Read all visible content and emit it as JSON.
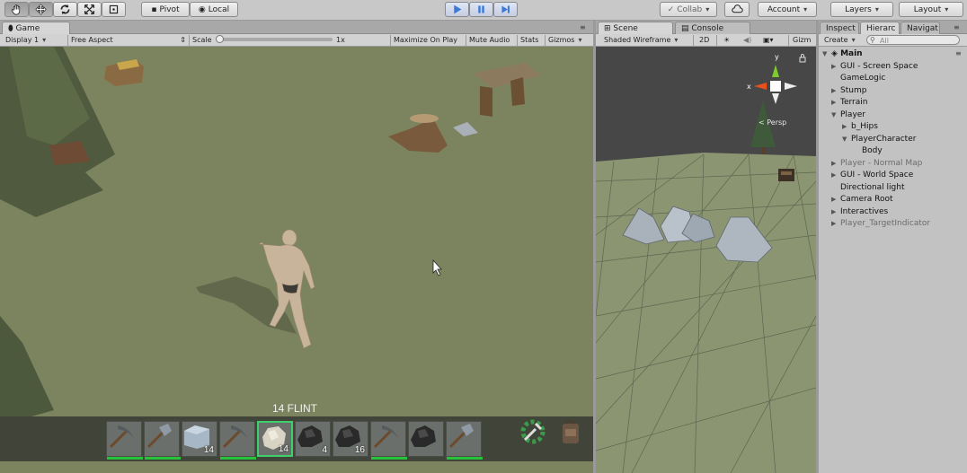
{
  "toolbar": {
    "pivot_label": "Pivot",
    "local_label": "Local",
    "collab_label": "Collab",
    "account_label": "Account",
    "layers_label": "Layers",
    "layout_label": "Layout",
    "accent_color": "#3a79d8"
  },
  "game_panel": {
    "tab_label": "Game",
    "display_label": "Display 1",
    "aspect_label": "Free Aspect",
    "scale_label": "Scale",
    "scale_value": "1x",
    "maximize_label": "Maximize On Play",
    "mute_label": "Mute Audio",
    "stats_label": "Stats",
    "gizmos_label": "Gizmos",
    "selected_item_text": "14 FLINT",
    "hotbar": [
      {
        "icon": "pickaxe-icon",
        "count": "",
        "durability": 1
      },
      {
        "icon": "hammer-icon",
        "count": "",
        "durability": 1
      },
      {
        "icon": "stone-block-icon",
        "count": "14",
        "durability": 0
      },
      {
        "icon": "pickaxe-icon",
        "count": "",
        "durability": 1
      },
      {
        "icon": "flint-icon",
        "count": "14",
        "durability": 0
      },
      {
        "icon": "coal-icon",
        "count": "4",
        "durability": 0
      },
      {
        "icon": "coal-icon",
        "count": "16",
        "durability": 0
      },
      {
        "icon": "pickaxe-icon",
        "count": "",
        "durability": 1
      },
      {
        "icon": "coal-icon",
        "count": "",
        "durability": 0
      },
      {
        "icon": "hammer-icon",
        "count": "",
        "durability": 1
      }
    ]
  },
  "scene_panel": {
    "scene_tab": "Scene",
    "console_tab": "Console",
    "shading_label": "Shaded Wireframe",
    "mode_2d": "2D",
    "gizmos_label": "Gizm",
    "persp_label": "< Persp",
    "axis_y": "y",
    "axis_x": "x"
  },
  "hierarchy_panel": {
    "inspector_tab": "Inspect",
    "hierarchy_tab": "Hierarc",
    "navigation_tab": "Navigat",
    "create_label": "Create",
    "search_placeholder": "All",
    "items": [
      {
        "label": "Main",
        "indent": 0,
        "arrow": "▼",
        "dim": false
      },
      {
        "label": "GUI - Screen Space",
        "indent": 1,
        "arrow": "▶",
        "dim": false
      },
      {
        "label": "GameLogic",
        "indent": 1,
        "arrow": "",
        "dim": false
      },
      {
        "label": "Stump",
        "indent": 1,
        "arrow": "▶",
        "dim": false
      },
      {
        "label": "Terrain",
        "indent": 1,
        "arrow": "▶",
        "dim": false
      },
      {
        "label": "Player",
        "indent": 1,
        "arrow": "▼",
        "dim": false
      },
      {
        "label": "b_Hips",
        "indent": 2,
        "arrow": "▶",
        "dim": false
      },
      {
        "label": "PlayerCharacter",
        "indent": 2,
        "arrow": "▼",
        "dim": false
      },
      {
        "label": "Body",
        "indent": 3,
        "arrow": "",
        "dim": false
      },
      {
        "label": "Player - Normal Map",
        "indent": 1,
        "arrow": "▶",
        "dim": true
      },
      {
        "label": "GUI - World Space",
        "indent": 1,
        "arrow": "▶",
        "dim": false
      },
      {
        "label": "Directional light",
        "indent": 1,
        "arrow": "",
        "dim": false
      },
      {
        "label": "Camera Root",
        "indent": 1,
        "arrow": "▶",
        "dim": false
      },
      {
        "label": "Interactives",
        "indent": 1,
        "arrow": "▶",
        "dim": false
      },
      {
        "label": "Player_TargetIndicator",
        "indent": 1,
        "arrow": "▶",
        "dim": true
      }
    ]
  }
}
